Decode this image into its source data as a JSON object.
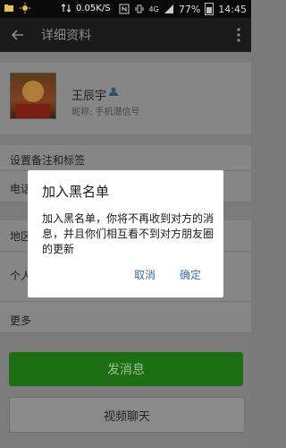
{
  "statusbar": {
    "speed": "0.05K/S",
    "network": "4G",
    "battery": "77%",
    "time": "14:45"
  },
  "header": {
    "title": "详细资料"
  },
  "profile": {
    "name": "王辰宇",
    "nickname": "昵称: 手机潜信号"
  },
  "rows": {
    "remark": "设置备注和标签",
    "phone": "电话",
    "region": "地区",
    "personal": "个人",
    "more": "更多"
  },
  "buttons": {
    "send": "发消息",
    "video": "视频聊天"
  },
  "dialog": {
    "title": "加入黑名单",
    "message": "加入黑名单，你将不再收到对方的消息，并且你们相互看不到对方朋友圈的更新",
    "cancel": "取消",
    "ok": "确定"
  }
}
